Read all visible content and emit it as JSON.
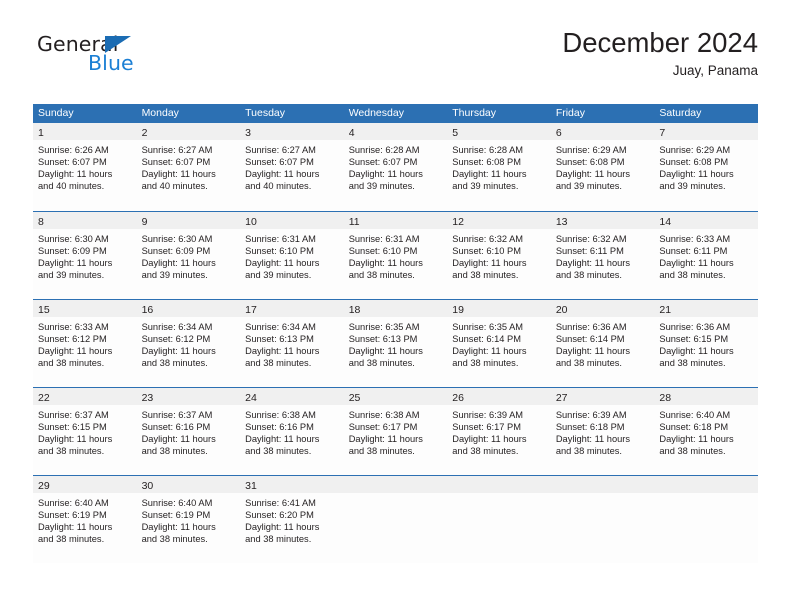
{
  "logo": {
    "word1": "General",
    "word2": "Blue",
    "triangle_color": "#1b6cb3",
    "word1_color": "#231f20",
    "word2_color": "#1b7fd4"
  },
  "header": {
    "title": "December 2024",
    "subtitle": "Juay, Panama"
  },
  "theme": {
    "header_blue": "#2c70b3",
    "day_band_gray": "#f0f0f0",
    "cell_white": "#fdfdfd",
    "text": "#231f20"
  },
  "weekdays": [
    "Sunday",
    "Monday",
    "Tuesday",
    "Wednesday",
    "Thursday",
    "Friday",
    "Saturday"
  ],
  "weeks": [
    [
      {
        "day": "1",
        "lines": [
          "Sunrise: 6:26 AM",
          "Sunset: 6:07 PM",
          "Daylight: 11 hours",
          "and 40 minutes."
        ]
      },
      {
        "day": "2",
        "lines": [
          "Sunrise: 6:27 AM",
          "Sunset: 6:07 PM",
          "Daylight: 11 hours",
          "and 40 minutes."
        ]
      },
      {
        "day": "3",
        "lines": [
          "Sunrise: 6:27 AM",
          "Sunset: 6:07 PM",
          "Daylight: 11 hours",
          "and 40 minutes."
        ]
      },
      {
        "day": "4",
        "lines": [
          "Sunrise: 6:28 AM",
          "Sunset: 6:07 PM",
          "Daylight: 11 hours",
          "and 39 minutes."
        ]
      },
      {
        "day": "5",
        "lines": [
          "Sunrise: 6:28 AM",
          "Sunset: 6:08 PM",
          "Daylight: 11 hours",
          "and 39 minutes."
        ]
      },
      {
        "day": "6",
        "lines": [
          "Sunrise: 6:29 AM",
          "Sunset: 6:08 PM",
          "Daylight: 11 hours",
          "and 39 minutes."
        ]
      },
      {
        "day": "7",
        "lines": [
          "Sunrise: 6:29 AM",
          "Sunset: 6:08 PM",
          "Daylight: 11 hours",
          "and 39 minutes."
        ]
      }
    ],
    [
      {
        "day": "8",
        "lines": [
          "Sunrise: 6:30 AM",
          "Sunset: 6:09 PM",
          "Daylight: 11 hours",
          "and 39 minutes."
        ]
      },
      {
        "day": "9",
        "lines": [
          "Sunrise: 6:30 AM",
          "Sunset: 6:09 PM",
          "Daylight: 11 hours",
          "and 39 minutes."
        ]
      },
      {
        "day": "10",
        "lines": [
          "Sunrise: 6:31 AM",
          "Sunset: 6:10 PM",
          "Daylight: 11 hours",
          "and 39 minutes."
        ]
      },
      {
        "day": "11",
        "lines": [
          "Sunrise: 6:31 AM",
          "Sunset: 6:10 PM",
          "Daylight: 11 hours",
          "and 38 minutes."
        ]
      },
      {
        "day": "12",
        "lines": [
          "Sunrise: 6:32 AM",
          "Sunset: 6:10 PM",
          "Daylight: 11 hours",
          "and 38 minutes."
        ]
      },
      {
        "day": "13",
        "lines": [
          "Sunrise: 6:32 AM",
          "Sunset: 6:11 PM",
          "Daylight: 11 hours",
          "and 38 minutes."
        ]
      },
      {
        "day": "14",
        "lines": [
          "Sunrise: 6:33 AM",
          "Sunset: 6:11 PM",
          "Daylight: 11 hours",
          "and 38 minutes."
        ]
      }
    ],
    [
      {
        "day": "15",
        "lines": [
          "Sunrise: 6:33 AM",
          "Sunset: 6:12 PM",
          "Daylight: 11 hours",
          "and 38 minutes."
        ]
      },
      {
        "day": "16",
        "lines": [
          "Sunrise: 6:34 AM",
          "Sunset: 6:12 PM",
          "Daylight: 11 hours",
          "and 38 minutes."
        ]
      },
      {
        "day": "17",
        "lines": [
          "Sunrise: 6:34 AM",
          "Sunset: 6:13 PM",
          "Daylight: 11 hours",
          "and 38 minutes."
        ]
      },
      {
        "day": "18",
        "lines": [
          "Sunrise: 6:35 AM",
          "Sunset: 6:13 PM",
          "Daylight: 11 hours",
          "and 38 minutes."
        ]
      },
      {
        "day": "19",
        "lines": [
          "Sunrise: 6:35 AM",
          "Sunset: 6:14 PM",
          "Daylight: 11 hours",
          "and 38 minutes."
        ]
      },
      {
        "day": "20",
        "lines": [
          "Sunrise: 6:36 AM",
          "Sunset: 6:14 PM",
          "Daylight: 11 hours",
          "and 38 minutes."
        ]
      },
      {
        "day": "21",
        "lines": [
          "Sunrise: 6:36 AM",
          "Sunset: 6:15 PM",
          "Daylight: 11 hours",
          "and 38 minutes."
        ]
      }
    ],
    [
      {
        "day": "22",
        "lines": [
          "Sunrise: 6:37 AM",
          "Sunset: 6:15 PM",
          "Daylight: 11 hours",
          "and 38 minutes."
        ]
      },
      {
        "day": "23",
        "lines": [
          "Sunrise: 6:37 AM",
          "Sunset: 6:16 PM",
          "Daylight: 11 hours",
          "and 38 minutes."
        ]
      },
      {
        "day": "24",
        "lines": [
          "Sunrise: 6:38 AM",
          "Sunset: 6:16 PM",
          "Daylight: 11 hours",
          "and 38 minutes."
        ]
      },
      {
        "day": "25",
        "lines": [
          "Sunrise: 6:38 AM",
          "Sunset: 6:17 PM",
          "Daylight: 11 hours",
          "and 38 minutes."
        ]
      },
      {
        "day": "26",
        "lines": [
          "Sunrise: 6:39 AM",
          "Sunset: 6:17 PM",
          "Daylight: 11 hours",
          "and 38 minutes."
        ]
      },
      {
        "day": "27",
        "lines": [
          "Sunrise: 6:39 AM",
          "Sunset: 6:18 PM",
          "Daylight: 11 hours",
          "and 38 minutes."
        ]
      },
      {
        "day": "28",
        "lines": [
          "Sunrise: 6:40 AM",
          "Sunset: 6:18 PM",
          "Daylight: 11 hours",
          "and 38 minutes."
        ]
      }
    ],
    [
      {
        "day": "29",
        "lines": [
          "Sunrise: 6:40 AM",
          "Sunset: 6:19 PM",
          "Daylight: 11 hours",
          "and 38 minutes."
        ]
      },
      {
        "day": "30",
        "lines": [
          "Sunrise: 6:40 AM",
          "Sunset: 6:19 PM",
          "Daylight: 11 hours",
          "and 38 minutes."
        ]
      },
      {
        "day": "31",
        "lines": [
          "Sunrise: 6:41 AM",
          "Sunset: 6:20 PM",
          "Daylight: 11 hours",
          "and 38 minutes."
        ]
      },
      {
        "day": "",
        "lines": []
      },
      {
        "day": "",
        "lines": []
      },
      {
        "day": "",
        "lines": []
      },
      {
        "day": "",
        "lines": []
      }
    ]
  ]
}
